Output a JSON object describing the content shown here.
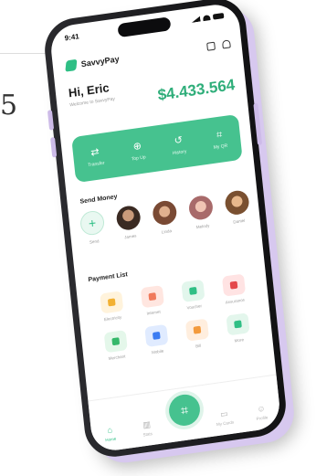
{
  "backdrop": {
    "glyph": "5"
  },
  "status_bar": {
    "time": "9:41"
  },
  "app": {
    "brand_name": "SavvyPay"
  },
  "greeting": {
    "title": "Hi, Eric",
    "subtitle": "Welcome to SavvyPay"
  },
  "balance": {
    "amount": "$4.433.564"
  },
  "actions": [
    {
      "label": "Transfer",
      "icon": "transfer-icon"
    },
    {
      "label": "Top Up",
      "icon": "top-up-icon"
    },
    {
      "label": "History",
      "icon": "history-icon"
    },
    {
      "label": "My QR",
      "icon": "qr-icon"
    }
  ],
  "send_money": {
    "title": "Send Money",
    "contacts": [
      {
        "name": "Send",
        "type": "add"
      },
      {
        "name": "James",
        "color": "#3a2a22"
      },
      {
        "name": "Linda",
        "color": "#7a4a34"
      },
      {
        "name": "Melody",
        "color": "#a86a6a"
      },
      {
        "name": "Daniel",
        "color": "#7a5030"
      }
    ]
  },
  "payment_list": {
    "title": "Payment List",
    "items": [
      {
        "label": "Electricity",
        "bg": "#fff3dc",
        "fg": "#f2b134"
      },
      {
        "label": "Internet",
        "bg": "#ffe6e0",
        "fg": "#f07a5c"
      },
      {
        "label": "Voucher",
        "bg": "#e2f6ec",
        "fg": "#2fbf85"
      },
      {
        "label": "Assurance",
        "bg": "#ffe3e3",
        "fg": "#e4474a"
      },
      {
        "label": "Merchant",
        "bg": "#e4f7ea",
        "fg": "#35b86a"
      },
      {
        "label": "Mobile",
        "bg": "#e0ebff",
        "fg": "#3b7cf2"
      },
      {
        "label": "Bill",
        "bg": "#ffeede",
        "fg": "#f39a3c"
      },
      {
        "label": "More",
        "bg": "#e3f6ec",
        "fg": "#2fbf85"
      }
    ]
  },
  "bottom_nav": [
    {
      "label": "Home",
      "active": true
    },
    {
      "label": "Stats",
      "active": false
    },
    {
      "label": "",
      "scan": true
    },
    {
      "label": "My Cards",
      "active": false
    },
    {
      "label": "Profile",
      "active": false
    }
  ]
}
